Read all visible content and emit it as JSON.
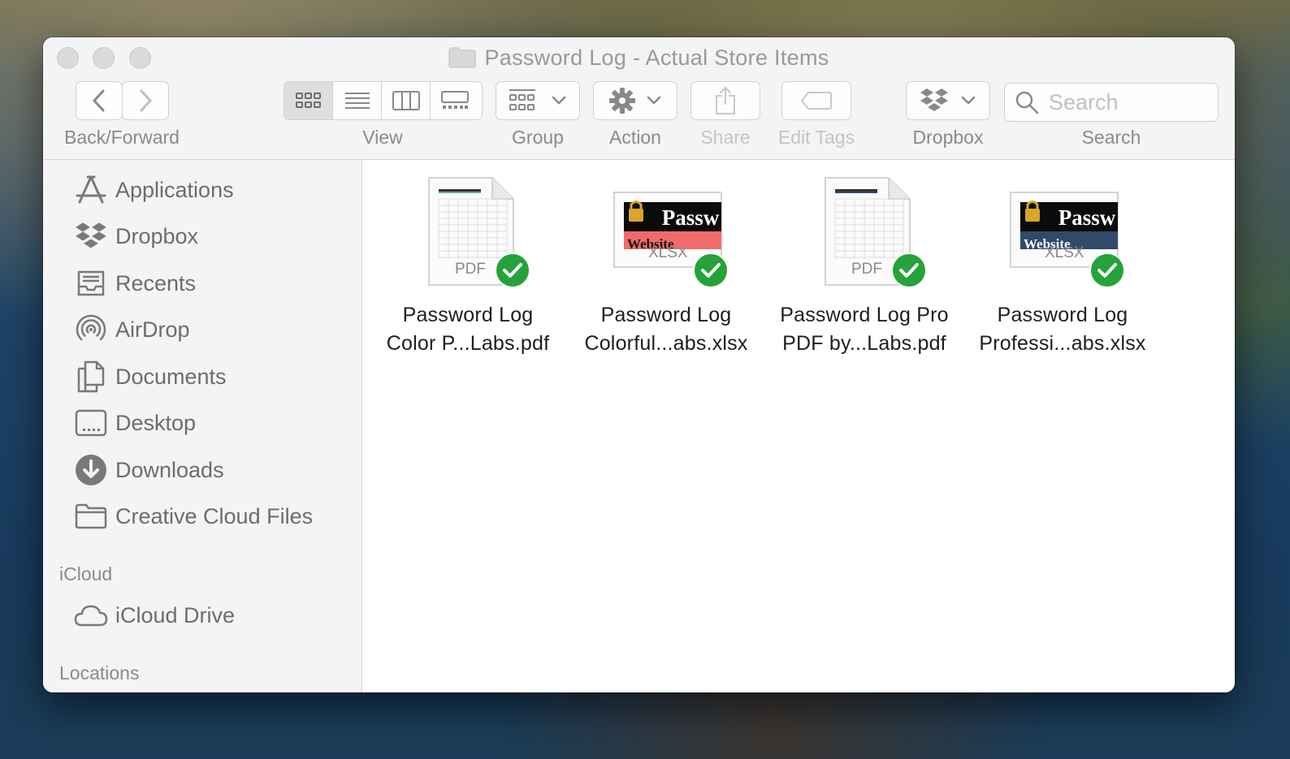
{
  "window": {
    "title": "Password Log - Actual Store Items"
  },
  "toolbar": {
    "back_forward_label": "Back/Forward",
    "view_label": "View",
    "group_label": "Group",
    "action_label": "Action",
    "share_label": "Share",
    "edit_tags_label": "Edit Tags",
    "dropbox_label": "Dropbox",
    "search_label": "Search",
    "search_placeholder": "Search",
    "active_view": "icon"
  },
  "sidebar": {
    "favorites": [
      {
        "label": "Applications",
        "icon": "applications-icon"
      },
      {
        "label": "Dropbox",
        "icon": "dropbox-icon"
      },
      {
        "label": "Recents",
        "icon": "recents-icon"
      },
      {
        "label": "AirDrop",
        "icon": "airdrop-icon"
      },
      {
        "label": "Documents",
        "icon": "documents-icon"
      },
      {
        "label": "Desktop",
        "icon": "desktop-icon"
      },
      {
        "label": "Downloads",
        "icon": "downloads-icon"
      },
      {
        "label": "Creative Cloud Files",
        "icon": "folder-icon"
      }
    ],
    "icloud_heading": "iCloud",
    "icloud_items": [
      {
        "label": "iCloud Drive",
        "icon": "cloud-icon"
      }
    ],
    "locations_heading": "Locations"
  },
  "files": [
    {
      "line1": "Password Log",
      "line2": "Color P...Labs.pdf",
      "type_badge": "PDF",
      "kind": "pdf",
      "synced": true
    },
    {
      "line1": "Password Log",
      "line2": "Colorful...abs.xlsx",
      "type_badge": "XLSX",
      "kind": "xlsx",
      "banner_top": "Passw",
      "banner_bottom": "Website",
      "accent": "#f26b6b",
      "synced": true
    },
    {
      "line1": "Password Log Pro",
      "line2": "PDF by...Labs.pdf",
      "type_badge": "PDF",
      "kind": "pdf",
      "synced": true
    },
    {
      "line1": "Password Log",
      "line2": "Professi...abs.xlsx",
      "type_badge": "XLSX",
      "kind": "xlsx",
      "banner_top": "Passw",
      "banner_bottom": "Website",
      "accent": "#2f4a6b",
      "synced": true
    }
  ],
  "colors": {
    "sync_check": "#25a33a",
    "sidebar_bg": "#f5f4f5"
  }
}
